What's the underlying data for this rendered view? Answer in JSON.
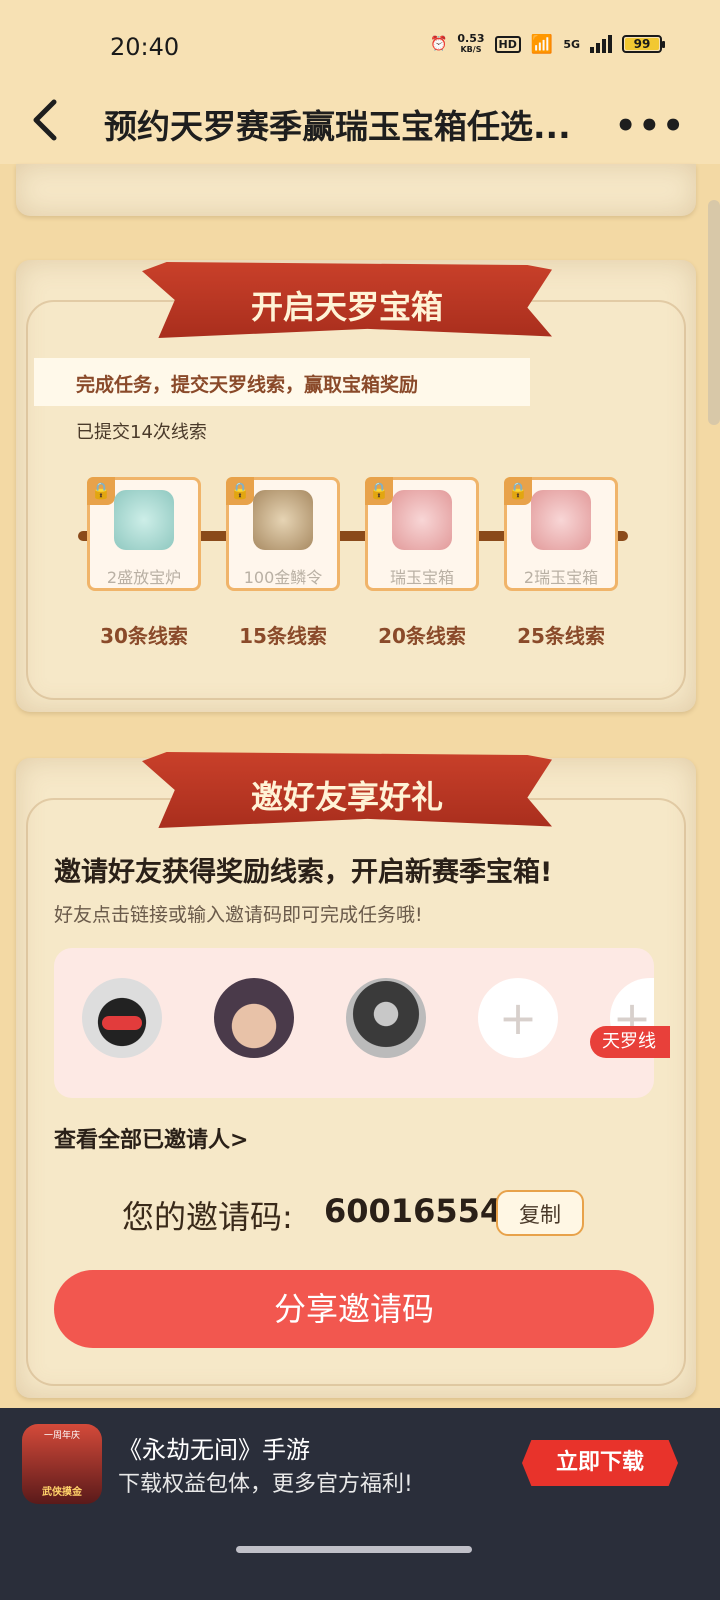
{
  "status_bar": {
    "time": "20:40",
    "net_speed": "0.53",
    "net_unit": "KB/S",
    "hd": "HD",
    "signal": "5G",
    "battery": "99"
  },
  "header": {
    "title": "预约天罗赛季赢瑞玉宝箱任选...",
    "back_icon": "chevron-left-icon",
    "more_icon": "more-dots-icon"
  },
  "treasure": {
    "banner": "开启天罗宝箱",
    "task_text": "完成任务，提交天罗线索，赢取宝箱奖励",
    "submitted_text": "已提交14次线索",
    "rewards": [
      {
        "name": "2盛放宝炉",
        "requirement": "30条线索",
        "color": "#9fd6cf"
      },
      {
        "name": "100金鳞令",
        "requirement": "15条线索",
        "color": "#b9a07a"
      },
      {
        "name": "瑞玉宝箱",
        "requirement": "20条线索",
        "color": "#f0b4b4"
      },
      {
        "name": "2瑞玉宝箱",
        "requirement": "25条线索",
        "color": "#f0b4b4"
      }
    ]
  },
  "invite": {
    "banner": "邀好友享好礼",
    "title": "邀请好友获得奖励线索，开启新赛季宝箱!",
    "subtitle": "好友点击链接或输入邀请码即可完成任务哦!",
    "tag": "天罗线",
    "view_all": "查看全部已邀请人>",
    "code_label": "您的邀请码:",
    "code_value": "60016554",
    "copy_label": "复制",
    "share_label": "分享邀请码"
  },
  "ad": {
    "title": "《永劫无间》手游",
    "subtitle": "下载权益包体，更多官方福利!",
    "download_label": "立即下载",
    "icon_top_text": "一周年庆",
    "icon_bottom_text": "武侠摸金"
  }
}
